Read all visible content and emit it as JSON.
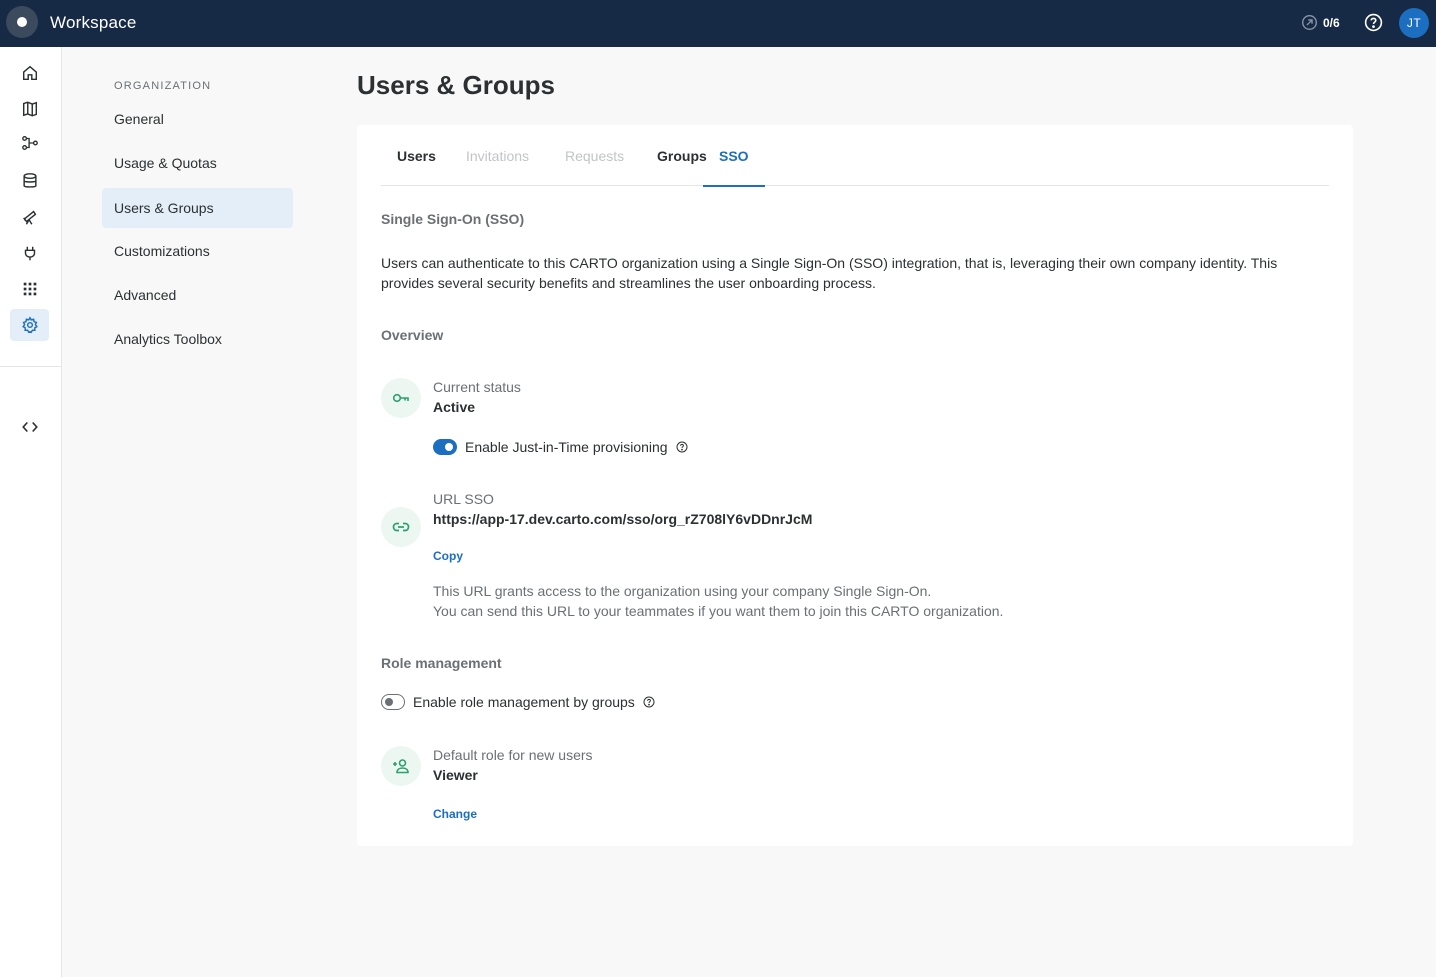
{
  "topbar": {
    "app_title": "Workspace",
    "onboarding_progress": "0/6",
    "avatar_initials": "JT"
  },
  "rail": {
    "items": [
      "home-icon",
      "map-icon",
      "workflows-icon",
      "data-icon",
      "explore-icon",
      "connections-icon",
      "apps-icon",
      "settings-icon",
      "developers-icon"
    ],
    "active": "settings-icon"
  },
  "org_nav": {
    "header": "ORGANIZATION",
    "items": [
      {
        "label": "General"
      },
      {
        "label": "Usage & Quotas"
      },
      {
        "label": "Users & Groups"
      },
      {
        "label": "Customizations"
      },
      {
        "label": "Advanced"
      },
      {
        "label": "Analytics Toolbox"
      }
    ],
    "active": "Users & Groups"
  },
  "page": {
    "title": "Users & Groups"
  },
  "tabs": [
    {
      "label": "Users",
      "state": "normal"
    },
    {
      "label": "Invitations",
      "state": "disabled"
    },
    {
      "label": "Requests",
      "state": "disabled"
    },
    {
      "label": "Groups",
      "state": "normal"
    },
    {
      "label": "SSO",
      "state": "active"
    }
  ],
  "sso": {
    "title": "Single Sign-On (SSO)",
    "description": "Users can authenticate to this CARTO organization using a Single Sign-On (SSO) integration, that is, leveraging their own company identity. This provides several security benefits and streamlines the user onboarding process.",
    "overview_title": "Overview",
    "status_label": "Current status",
    "status_value": "Active",
    "jit_label": "Enable Just-in-Time provisioning",
    "jit_enabled": true,
    "url_label": "URL SSO",
    "url_value": "https://app-17.dev.carto.com/sso/org_rZ708lY6vDDnrJcM",
    "copy_label": "Copy",
    "url_note_1": "This URL grants access to the organization using your company Single Sign-On.",
    "url_note_2": "You can send this URL to your teammates if you want them to join this CARTO organization.",
    "role_title": "Role management",
    "role_toggle_label": "Enable role management by groups",
    "role_toggle_enabled": false,
    "default_role_label": "Default role for new users",
    "default_role_value": "Viewer",
    "change_label": "Change"
  },
  "colors": {
    "topbar": "#162945",
    "accent": "#1c6ec0",
    "icon_green": "#2e9f6e",
    "icon_green_bg": "#ecf7f2"
  }
}
